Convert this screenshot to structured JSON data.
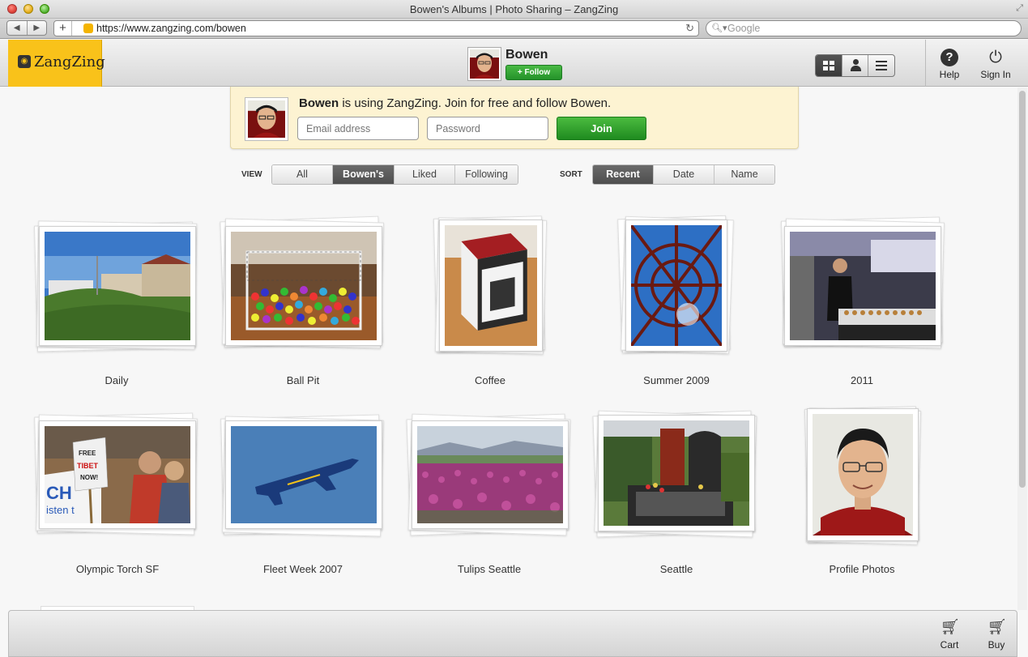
{
  "window": {
    "title": "Bowen's Albums | Photo Sharing – ZangZing",
    "url": "https://www.zangzing.com/bowen",
    "search_placeholder": "Google"
  },
  "header": {
    "logo": "ZangZing",
    "user_name": "Bowen",
    "follow_label": "+ Follow",
    "help_label": "Help",
    "signin_label": "Sign In"
  },
  "join": {
    "name": "Bowen",
    "message": " is using ZangZing. Join for free and follow Bowen.",
    "email_placeholder": "Email address",
    "password_placeholder": "Password",
    "join_label": "Join"
  },
  "view": {
    "label": "VIEW",
    "options": [
      "All",
      "Bowen's",
      "Liked",
      "Following"
    ],
    "active": "Bowen's"
  },
  "sort": {
    "label": "SORT",
    "options": [
      "Recent",
      "Date",
      "Name"
    ],
    "active": "Recent"
  },
  "albums": [
    {
      "title": "Daily"
    },
    {
      "title": "Ball Pit"
    },
    {
      "title": "Coffee"
    },
    {
      "title": "Summer 2009"
    },
    {
      "title": "2011"
    },
    {
      "title": "Olympic Torch SF"
    },
    {
      "title": "Fleet Week 2007"
    },
    {
      "title": "Tulips Seattle"
    },
    {
      "title": "Seattle"
    },
    {
      "title": "Profile Photos"
    }
  ],
  "footer": {
    "cart_label": "Cart",
    "buy_label": "Buy"
  }
}
